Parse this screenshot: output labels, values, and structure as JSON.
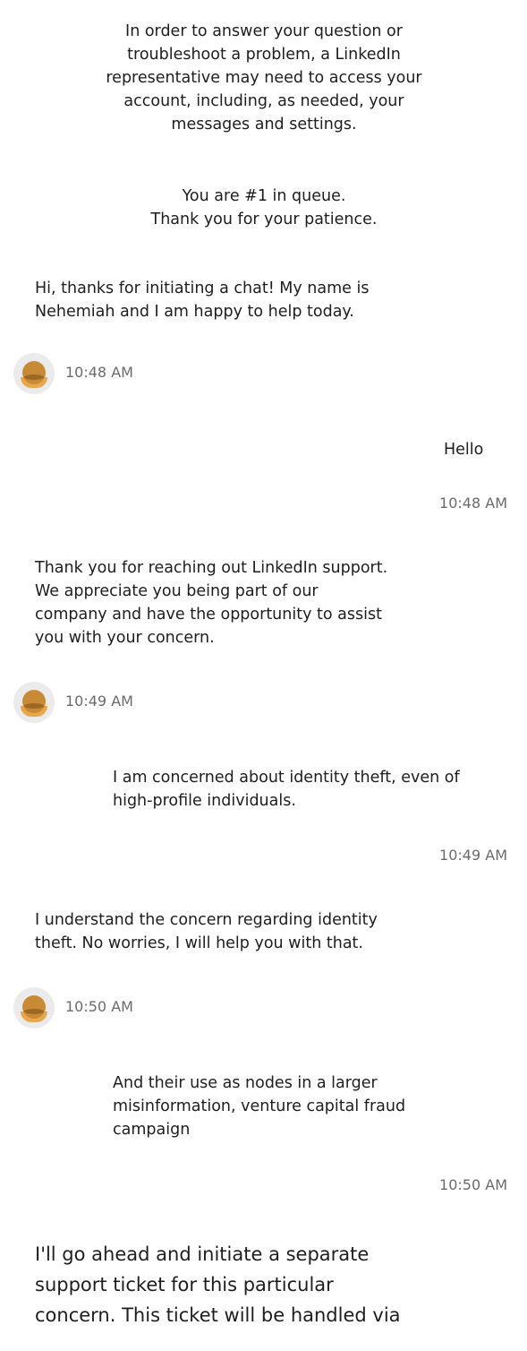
{
  "system_notice": "In order to answer your question or\ntroubleshoot a problem, a LinkedIn\nrepresentative may need to access your\naccount, including, as needed, your\nmessages and settings.",
  "queue_notice": "You are #1 in queue.\nThank you for your patience.",
  "messages": [
    {
      "sender": "agent",
      "text": "Hi, thanks for initiating a chat! My name is\nNehemiah and I am happy to help today.",
      "time": "10:48 AM"
    },
    {
      "sender": "user",
      "text": "Hello",
      "time": "10:48 AM"
    },
    {
      "sender": "agent",
      "text": "Thank you for reaching out LinkedIn support.\nWe appreciate you being part of our\ncompany and have the opportunity to assist\nyou with your concern.",
      "time": "10:49 AM"
    },
    {
      "sender": "user",
      "text": "I am concerned about identity theft, even of\nhigh-profile individuals.",
      "time": "10:49 AM"
    },
    {
      "sender": "agent",
      "text": "I understand the concern regarding identity\ntheft.  No worries, I will help you with that.",
      "time": "10:50 AM"
    },
    {
      "sender": "user",
      "text": "And their use as nodes in a larger\nmisinformation, venture capital fraud\ncampaign",
      "time": "10:50 AM"
    },
    {
      "sender": "agent",
      "text": "I'll go ahead and initiate a separate\nsupport ticket for this particular\nconcern. This ticket will be handled via"
    }
  ],
  "avatar_colors": {
    "head": "#c98a35",
    "body": "#e7a74e",
    "ring": "#ebebeb"
  }
}
